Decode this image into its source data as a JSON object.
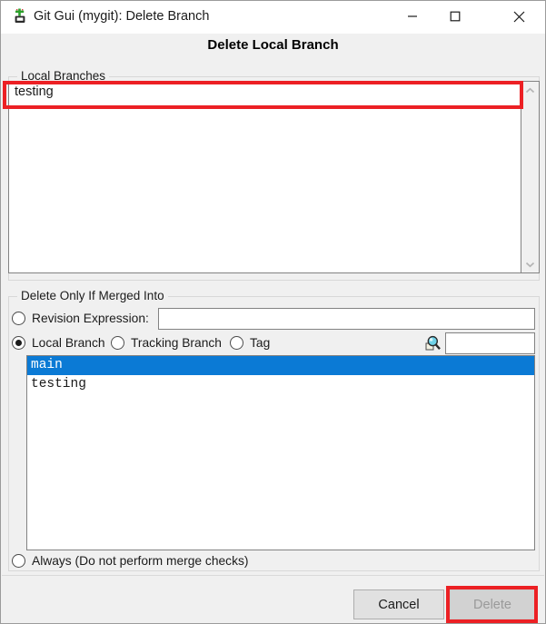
{
  "window": {
    "title": "Git Gui (mygit): Delete Branch",
    "icon": "git-gui-icon",
    "controls": {
      "minimize": "minimize-icon",
      "maximize": "maximize-icon",
      "close": "close-icon"
    }
  },
  "dialog": {
    "heading": "Delete Local Branch"
  },
  "local_branches": {
    "legend": "Local Branches",
    "items": [
      "testing"
    ],
    "scrollbar": {
      "up": "chevron-up-icon",
      "down": "chevron-down-icon"
    }
  },
  "merged_into": {
    "legend": "Delete Only If Merged Into",
    "options": [
      {
        "label": "Revision Expression:",
        "selected": false
      },
      {
        "label": "Local Branch",
        "selected": true
      },
      {
        "label": "Tracking Branch",
        "selected": false
      },
      {
        "label": "Tag",
        "selected": false
      }
    ],
    "revision_input": {
      "value": "",
      "placeholder": ""
    },
    "search_icon": "magnifier-icon",
    "search_input": {
      "value": "",
      "placeholder": ""
    },
    "branch_list": [
      {
        "name": "main",
        "selected": true
      },
      {
        "name": "testing",
        "selected": false
      }
    ]
  },
  "always": {
    "label": "Always (Do not perform merge checks)",
    "selected": false
  },
  "buttons": {
    "cancel": "Cancel",
    "delete": "Delete",
    "delete_enabled": false
  },
  "annotations": {
    "branch_highlight": "red-highlight-box",
    "delete_highlight": "red-highlight-box"
  },
  "colors": {
    "selection_blue": "#0b7ad5",
    "annotation_red": "#ec2024",
    "dialog_bg": "#f0f0f0",
    "disabled_text": "#9a9a9a"
  }
}
